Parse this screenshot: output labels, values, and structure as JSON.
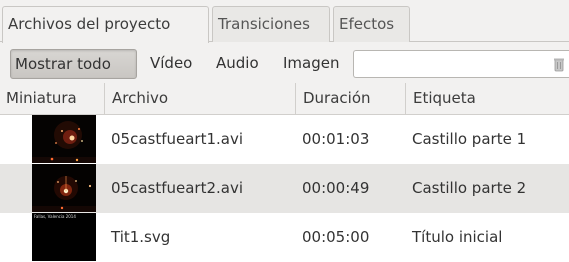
{
  "tabs": [
    {
      "label": "Archivos del proyecto",
      "active": true
    },
    {
      "label": "Transiciones",
      "active": false
    },
    {
      "label": "Efectos",
      "active": false
    }
  ],
  "filters": [
    {
      "label": "Mostrar todo",
      "selected": true
    },
    {
      "label": "Vídeo",
      "selected": false
    },
    {
      "label": "Audio",
      "selected": false
    },
    {
      "label": "Imagen",
      "selected": false
    }
  ],
  "search": {
    "value": "",
    "placeholder": "",
    "clear_icon": "clear-search-icon"
  },
  "table": {
    "columns": [
      "Miniatura",
      "Archivo",
      "Duración",
      "Etiqueta"
    ],
    "rows": [
      {
        "thumbnail": "fireworks-thumbnail",
        "file": "05castfueart1.avi",
        "duration": "00:01:03",
        "label": "Castillo parte 1"
      },
      {
        "thumbnail": "fireworks-thumbnail",
        "file": "05castfueart2.avi",
        "duration": "00:00:49",
        "label": "Castillo parte 2"
      },
      {
        "thumbnail": "title-thumbnail",
        "thumbnail_text": "Fallas, Valencia 2014",
        "file": "Tit1.svg",
        "duration": "00:05:00",
        "label": "Título inicial"
      }
    ]
  },
  "colors": {
    "window_bg": "#f2f1f0",
    "row_alt": "#e6e5e3",
    "selected_filter": "#cfccc8",
    "border": "#c9c7c4"
  }
}
